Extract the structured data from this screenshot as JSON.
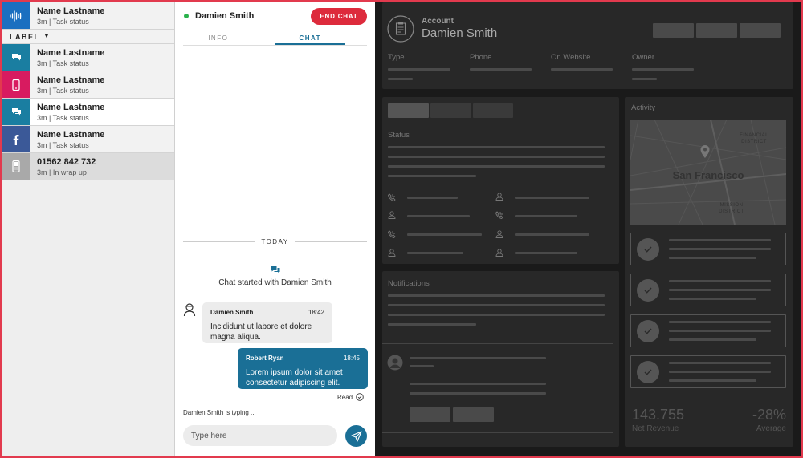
{
  "contacts": [
    {
      "name": "Name Lastname",
      "status": "3m | Task status",
      "channel": "voice-wave-icon",
      "color": "#1b6fc0"
    },
    {
      "name": "Name Lastname",
      "status": "3m | Task status",
      "channel": "chat-icon",
      "color": "#1a7ea1"
    },
    {
      "name": "Name Lastname",
      "status": "3m | Task status",
      "channel": "mobile-icon",
      "color": "#d81b60"
    },
    {
      "name": "Name Lastname",
      "status": "3m | Task status",
      "channel": "chat-icon",
      "color": "#1a7ea1"
    },
    {
      "name": "Name Lastname",
      "status": "3m | Task status",
      "channel": "facebook-icon",
      "color": "#3b5998"
    },
    {
      "name": "01562 842 732",
      "status": "3m | In wrap up",
      "channel": "phone-icon",
      "color": "#a9a9a9"
    }
  ],
  "label_filter": "LABEL",
  "chat": {
    "contact_name": "Damien Smith",
    "end_button": "END CHAT",
    "tabs": [
      "INFO",
      "CHAT"
    ],
    "divider": "TODAY",
    "started": "Chat started with Damien Smith",
    "messages": [
      {
        "author": "Damien Smith",
        "time": "18:42",
        "text": "Incididunt ut labore et dolore magna aliqua."
      },
      {
        "author": "Robert Ryan",
        "time": "18:45",
        "text": "Lorem ipsum dolor sit amet consectetur adipiscing elit."
      }
    ],
    "read_status": "Read",
    "typing": "Damien Smith is typing ...",
    "input_placeholder": "Type here"
  },
  "dashboard": {
    "account_label": "Account",
    "account_name": "Damien Smith",
    "fields": [
      "Type",
      "Phone",
      "On Website",
      "Owner"
    ],
    "status_title": "Status",
    "notifications_title": "Notifications",
    "activity_title": "Activity",
    "map_city": "San Francisco",
    "map_districts": [
      "FINANCIAL DISTRICT",
      "MISSION DISTRICT"
    ],
    "metrics": [
      {
        "value": "143.755",
        "label": "Net Revenue"
      },
      {
        "value": "-28%",
        "label": "Average"
      }
    ],
    "colors": {
      "frame": "#e23a4e",
      "accent": "#1a6f96",
      "end_chat": "#dd2b3c",
      "online": "#2bb24c"
    }
  }
}
